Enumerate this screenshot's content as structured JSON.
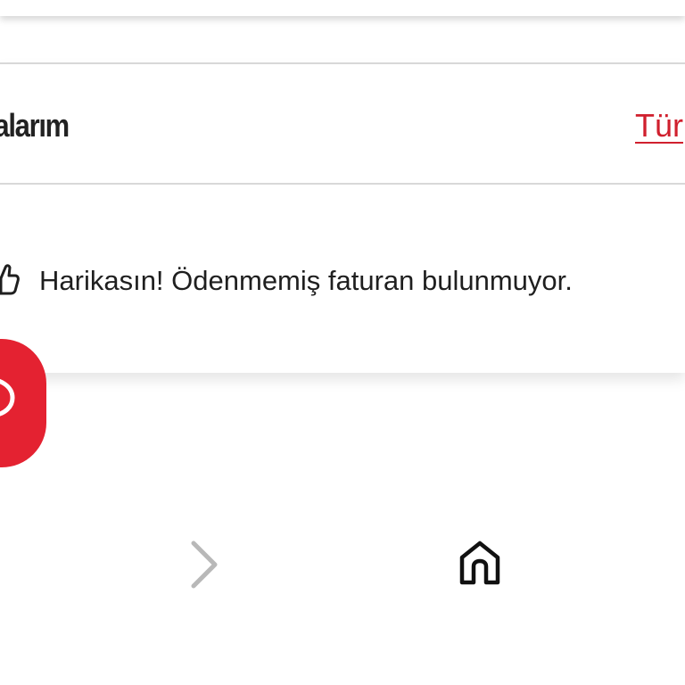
{
  "top_card": {},
  "bills": {
    "title": "turalarım",
    "see_all_link": "Tür",
    "empty_message": "Harikasın! Ödenmemiş faturan bulunmuyor."
  },
  "icons": {
    "thumb": "thumbs-up-icon",
    "chat": "chat-bubbles-icon",
    "forward": "chevron-right-icon",
    "home": "home-icon"
  },
  "colors": {
    "accent": "#e42231",
    "link": "#d0202e",
    "text": "#222222",
    "divider": "#d8d8d8",
    "chevron": "#b8b8b8"
  }
}
